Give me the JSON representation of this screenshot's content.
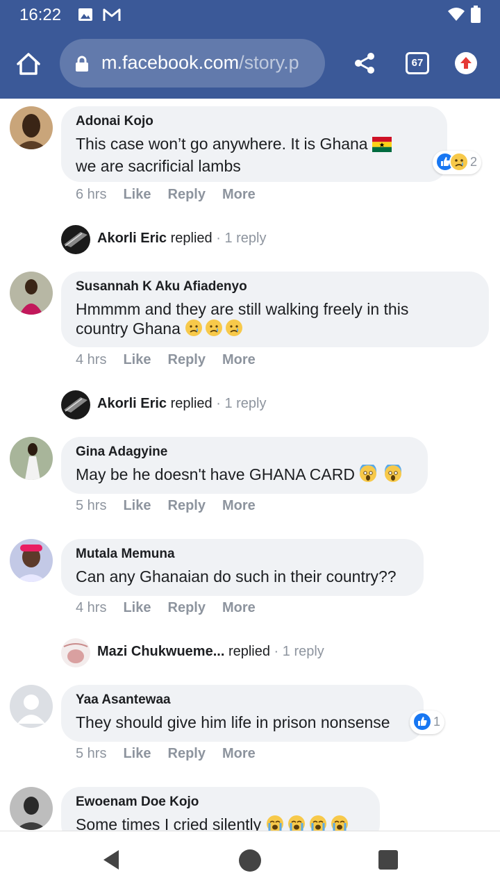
{
  "status_bar": {
    "time": "16:22",
    "notif_icons": [
      "image-icon",
      "gmail-icon"
    ],
    "system_icons": [
      "wifi-icon",
      "battery-icon"
    ]
  },
  "browser": {
    "url_domain": "m.facebook.com",
    "url_path": "/story.p",
    "tab_count": "67",
    "icons": [
      "home-icon",
      "lock-icon",
      "share-icon",
      "tabs-icon",
      "update-icon"
    ]
  },
  "labels": {
    "like": "Like",
    "reply": "Reply",
    "more": "More",
    "replied": "replied",
    "sep": "·"
  },
  "comments": [
    {
      "name": "Adonai Kojo",
      "text1": "This case won’t go anywhere. It is Ghana",
      "text2": "we are sacrificial lambs",
      "time": "6 hrs",
      "reaction_count": "2",
      "reactions": [
        "like",
        "sad"
      ]
    },
    {
      "name": "Susannah K Aku Afiadenyo",
      "text1": "Hmmmm and they are still walking freely in this",
      "text2": "country Ghana",
      "time": "4 hrs"
    },
    {
      "name": "Gina Adagyine",
      "text1": "May be he doesn't have GHANA CARD",
      "time": "5 hrs"
    },
    {
      "name": "Mutala Memuna",
      "text1": "Can any Ghanaian do such in their country??",
      "time": "4 hrs"
    },
    {
      "name": "Yaa Asantewaa",
      "text1": "They should give him life in prison nonsense",
      "time": "5 hrs",
      "reaction_count": "1",
      "reactions": [
        "like"
      ]
    },
    {
      "name": "Ewoenam Doe Kojo",
      "text1": "Some times I cried silently"
    }
  ],
  "replies": [
    {
      "name": "Akorli Eric",
      "count": "1 reply"
    },
    {
      "name": "Akorli Eric",
      "count": "1 reply"
    },
    {
      "name": "Mazi Chukwueme...",
      "count": "1 reply"
    }
  ],
  "colors": {
    "brand": "#3b5998",
    "bubble": "#f0f2f5",
    "meta": "#8d949e",
    "like_blue": "#1877f2"
  },
  "nav": [
    "back-icon",
    "home-icon",
    "recents-icon"
  ]
}
